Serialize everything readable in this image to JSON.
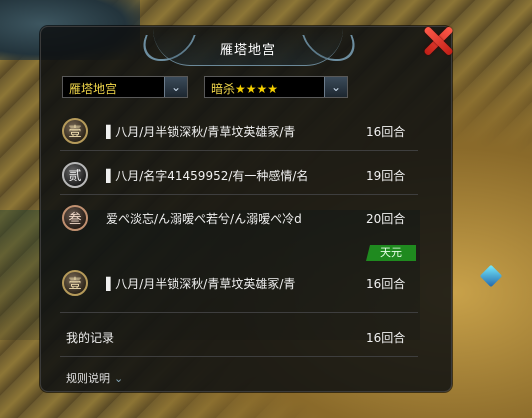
{
  "window": {
    "title": "雁塔地宫"
  },
  "filters": {
    "dungeon": {
      "selected": "雁塔地宫"
    },
    "difficulty": {
      "label": "暗杀",
      "stars": "★★★★"
    }
  },
  "ranking": [
    {
      "rank_glyph": "壹",
      "names": "▌八月/月半锁深秋/青草坟英雄冢/青",
      "turns": "16回合"
    },
    {
      "rank_glyph": "贰",
      "names": "▌八月/名字41459952/有一种感情/名",
      "turns": "19回合"
    },
    {
      "rank_glyph": "叁",
      "names": "爱ぺ淡忘/ん溺嗳ぺ若兮/ん溺嗳ぺ冷ⅾ",
      "turns": "20回合"
    }
  ],
  "server_tag": "天元",
  "server_best": {
    "rank_glyph": "壹",
    "names": "▌八月/月半锁深秋/青草坟英雄冢/青",
    "turns": "16回合"
  },
  "my_record": {
    "label": "我的记录",
    "turns": "16回合"
  },
  "rules": {
    "label": "规则说明"
  },
  "icons": {
    "close": "close-icon",
    "dropdown": "chevron-down-icon"
  },
  "colors": {
    "panel_bg": "#0e1012",
    "accent_yellow": "#f0d64a",
    "close_red": "#d02a20",
    "tag_green": "#1f8a1f"
  }
}
